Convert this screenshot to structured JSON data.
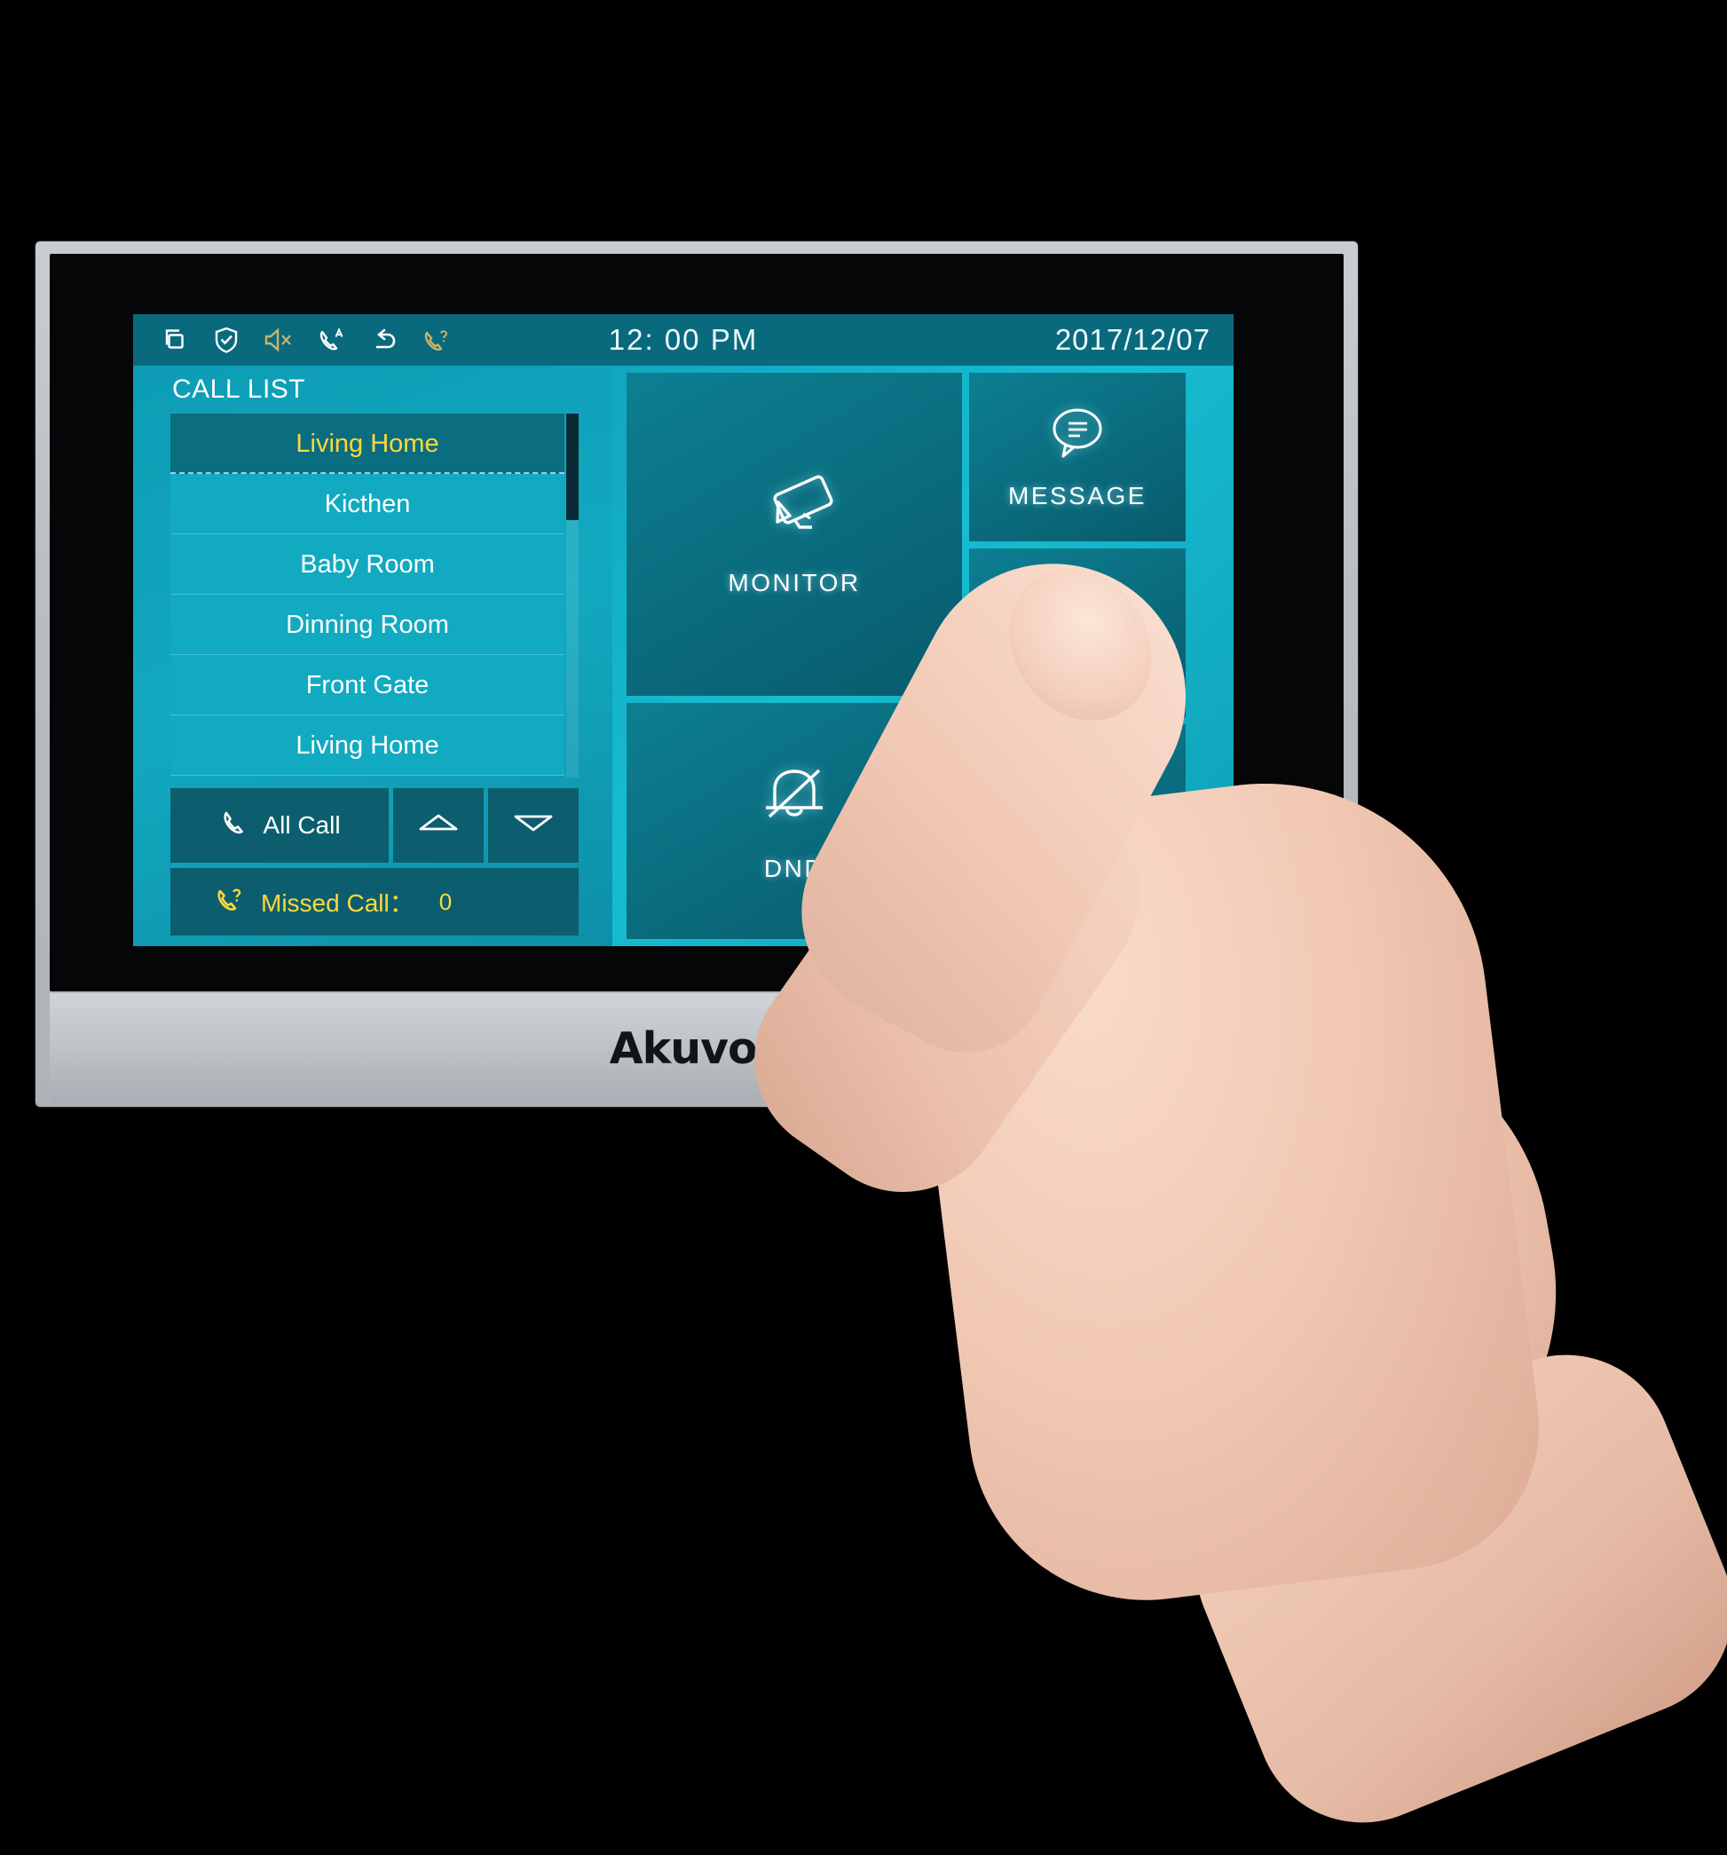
{
  "device": {
    "brand": "Akuvox",
    "product_type": "indoor-video-intercom-monitor"
  },
  "statusbar": {
    "icons": [
      {
        "name": "multi-window-icon",
        "color": "#ffffff"
      },
      {
        "name": "shield-check-icon",
        "color": "#ffffff"
      },
      {
        "name": "speaker-mute-icon",
        "color": "#c9b46a"
      },
      {
        "name": "auto-answer-call-icon",
        "color": "#ffffff"
      },
      {
        "name": "call-forward-icon",
        "color": "#ffffff"
      },
      {
        "name": "missed-call-icon",
        "color": "#c9b46a"
      }
    ],
    "time": "12: 00  PM",
    "date": "2017/12/07",
    "background": "#0a6a7d"
  },
  "call_list": {
    "title": "CALL LIST",
    "items": [
      {
        "label": "Living Home",
        "selected": true
      },
      {
        "label": "Kicthen",
        "selected": false
      },
      {
        "label": "Baby Room",
        "selected": false
      },
      {
        "label": "Dinning Room",
        "selected": false
      },
      {
        "label": "Front Gate",
        "selected": false
      },
      {
        "label": "Living Home",
        "selected": false
      }
    ],
    "selected_color": "#ffd83b",
    "row_color": "#12aac1",
    "selected_row_color": "#0b6d80"
  },
  "controls": {
    "all_call_label": "All Call",
    "scroll_up_label": "",
    "scroll_down_label": "",
    "missed_call_label": "Missed Call：",
    "missed_call_count": "0",
    "missed_call_color": "#ffd83b"
  },
  "tiles": [
    {
      "id": "monitor",
      "label": "MONITOR",
      "icon": "cctv-camera-icon"
    },
    {
      "id": "dnd",
      "label": "DND",
      "icon": "bell-slash-icon"
    },
    {
      "id": "message",
      "label": "MESSAGE",
      "icon": "speech-bubble-icon"
    },
    {
      "id": "unlock",
      "label": "",
      "icon": "obscured-icon"
    },
    {
      "id": "setting",
      "label": "",
      "icon": "obscured-icon"
    }
  ],
  "colors": {
    "lcd_background_start": "#0b93ad",
    "lcd_background_end": "#17bcd0",
    "tile_background": "#0a6b7d",
    "accent_yellow": "#ffd83b",
    "bezel_silver": "#bfc4c9",
    "page_background": "#000000"
  }
}
